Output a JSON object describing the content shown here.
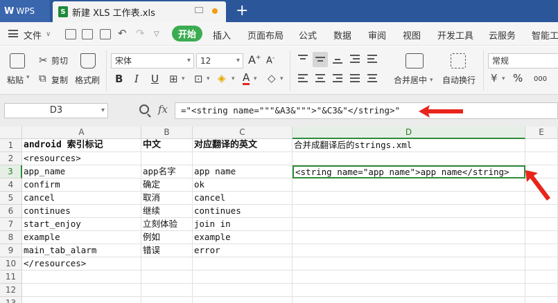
{
  "tabs": {
    "app_label": "WPS",
    "app_logo": "W",
    "document_title": "新建 XLS 工作表.xls",
    "file_icon": "S",
    "new_tab": "+"
  },
  "menu": {
    "file": "文件",
    "items": [
      "开始",
      "插入",
      "页面布局",
      "公式",
      "数据",
      "审阅",
      "视图",
      "开发工具",
      "云服务",
      "智能工"
    ]
  },
  "ribbon": {
    "paste": "粘贴",
    "cut": "剪切",
    "copy": "复制",
    "format_painter": "格式刷",
    "font_name": "宋体",
    "font_size": "12",
    "bold": "B",
    "italic": "I",
    "underline": "U",
    "merge_center": "合并居中",
    "wrap_text": "自动换行",
    "number_format": "常规",
    "percent": "%",
    "comma": "000"
  },
  "formula_bar": {
    "name_box": "D3",
    "fx": "fx",
    "formula": "=\"<string name=\"\"\"&A3&\"\"\">\"&C3&\"</string>\""
  },
  "grid": {
    "columns": [
      "A",
      "B",
      "C",
      "D",
      "E"
    ],
    "rows": [
      "1",
      "2",
      "3",
      "4",
      "5",
      "6",
      "7",
      "8",
      "9",
      "10",
      "11",
      "12",
      "13"
    ],
    "cells": [
      [
        "android 索引标记",
        "中文",
        "对应翻译的英文",
        "合并成翻译后的strings.xml"
      ],
      [
        "<resources>",
        "",
        "",
        ""
      ],
      [
        "app_name",
        "app名字",
        "app name",
        "<string name=\"app name\">app name</string>"
      ],
      [
        "confirm",
        "确定",
        "ok",
        ""
      ],
      [
        "cancel",
        "取消",
        "cancel",
        ""
      ],
      [
        "continues",
        "继续",
        "continues",
        ""
      ],
      [
        "start_enjoy",
        "立刻体验",
        "join in",
        ""
      ],
      [
        "example",
        "例如",
        "example",
        ""
      ],
      [
        "main_tab_alarm",
        "错误",
        "error",
        ""
      ],
      [
        "</resources>",
        "",
        "",
        ""
      ],
      [
        "",
        "",
        "",
        ""
      ],
      [
        "",
        "",
        "",
        ""
      ],
      [
        "",
        "",
        "",
        ""
      ]
    ]
  },
  "colors": {
    "tabbar": "#2b579a",
    "accent_green": "#3cac52",
    "selection": "#2e8b3a",
    "annotation_red": "#e8241b"
  }
}
